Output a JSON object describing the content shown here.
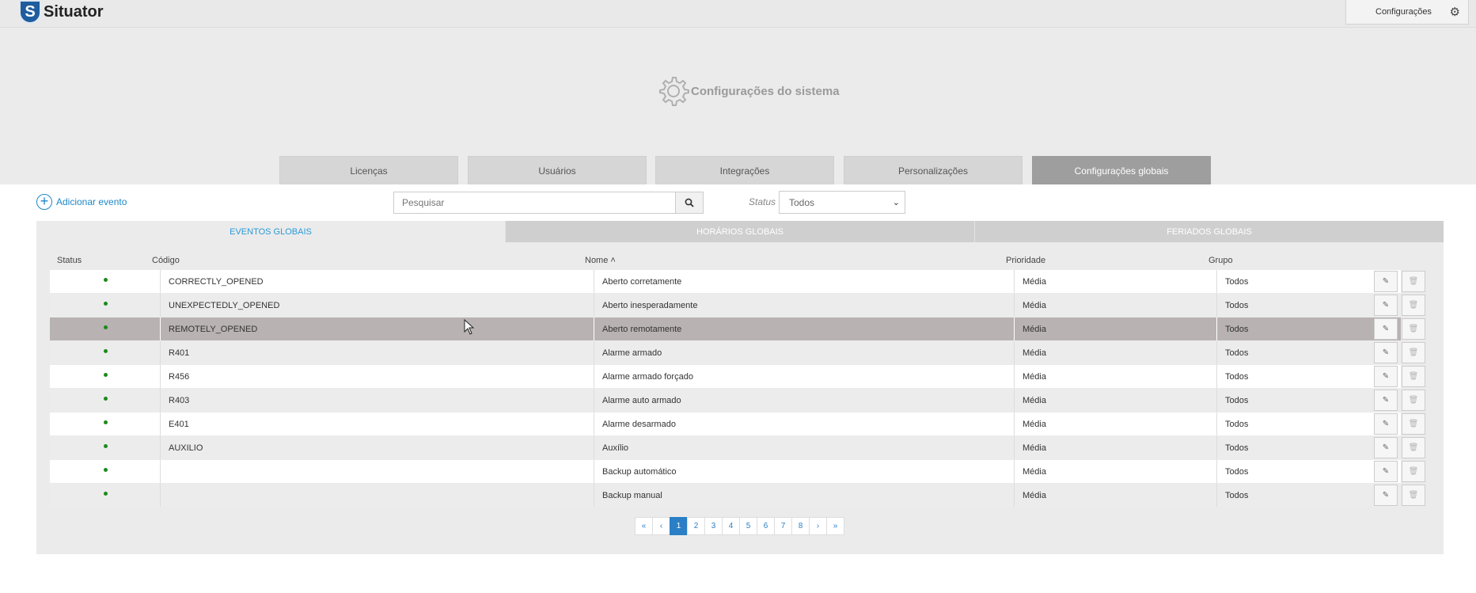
{
  "app": {
    "name": "Situator",
    "logo_letter": "S"
  },
  "header": {
    "config_button_label": "Configurações"
  },
  "hero": {
    "title": "Configurações do sistema"
  },
  "main_tabs": [
    {
      "label": "Licenças",
      "active": false
    },
    {
      "label": "Usuários",
      "active": false
    },
    {
      "label": "Integrações",
      "active": false
    },
    {
      "label": "Personalizações",
      "active": false
    },
    {
      "label": "Configurações globais",
      "active": true
    }
  ],
  "toolbar": {
    "add_event_label": "Adicionar evento",
    "search_placeholder": "Pesquisar",
    "status_label": "Status",
    "status_value": "Todos"
  },
  "sub_tabs": [
    {
      "label": "EVENTOS GLOBAIS",
      "active": true
    },
    {
      "label": "HORÁRIOS GLOBAIS",
      "active": false
    },
    {
      "label": "FERIADOS GLOBAIS",
      "active": false
    }
  ],
  "table": {
    "columns": [
      "Status",
      "Código",
      "Nome",
      "Prioridade",
      "Grupo"
    ],
    "sort_indicator": "˄",
    "rows": [
      {
        "code": "CORRECTLY_OPENED",
        "name": "Aberto corretamente",
        "priority": "Média",
        "group": "Todos"
      },
      {
        "code": "UNEXPECTEDLY_OPENED",
        "name": "Aberto inesperadamente",
        "priority": "Média",
        "group": "Todos"
      },
      {
        "code": "REMOTELY_OPENED",
        "name": "Aberto remotamente",
        "priority": "Média",
        "group": "Todos"
      },
      {
        "code": "R401",
        "name": "Alarme armado",
        "priority": "Média",
        "group": "Todos"
      },
      {
        "code": "R456",
        "name": "Alarme armado forçado",
        "priority": "Média",
        "group": "Todos"
      },
      {
        "code": "R403",
        "name": "Alarme auto armado",
        "priority": "Média",
        "group": "Todos"
      },
      {
        "code": "E401",
        "name": "Alarme desarmado",
        "priority": "Média",
        "group": "Todos"
      },
      {
        "code": "AUXILIO",
        "name": "Auxílio",
        "priority": "Média",
        "group": "Todos"
      },
      {
        "code": "",
        "name": "Backup automático",
        "priority": "Média",
        "group": "Todos"
      },
      {
        "code": "",
        "name": "Backup manual",
        "priority": "Média",
        "group": "Todos"
      }
    ]
  },
  "pagination": {
    "items": [
      "«",
      "‹",
      "1",
      "2",
      "3",
      "4",
      "5",
      "6",
      "7",
      "8",
      "›",
      "»"
    ],
    "active": "1"
  },
  "colors": {
    "accent": "#2b7fc6",
    "link": "#1e88c7",
    "status_dot": "#1a8a1a",
    "active_tab": "#9e9e9e"
  }
}
